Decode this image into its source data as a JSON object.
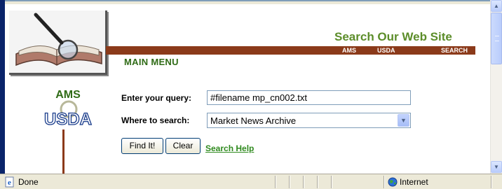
{
  "header": {
    "title": "Search Our Web Site",
    "nav_links": [
      "AMS",
      "USDA",
      "SEARCH"
    ],
    "main_menu": "MAIN MENU"
  },
  "logo": {
    "text_top": "AMS",
    "text_bottom": "USDA"
  },
  "form": {
    "query_label": "Enter your query:",
    "query_value": "#filename mp_cn002.txt",
    "where_label": "Where to search:",
    "where_value": "Market News Archive",
    "find_button": "Find It!",
    "clear_button": "Clear",
    "help_link": "Search Help"
  },
  "statusbar": {
    "status": "Done",
    "zone": "Internet",
    "icons": [
      "ie-page-icon",
      "globe-icon"
    ]
  },
  "colors": {
    "title_green": "#5c8d2a",
    "bar_brown": "#8b3a1a",
    "menu_green": "#2f6b16",
    "link_green": "#2f8a1e"
  }
}
